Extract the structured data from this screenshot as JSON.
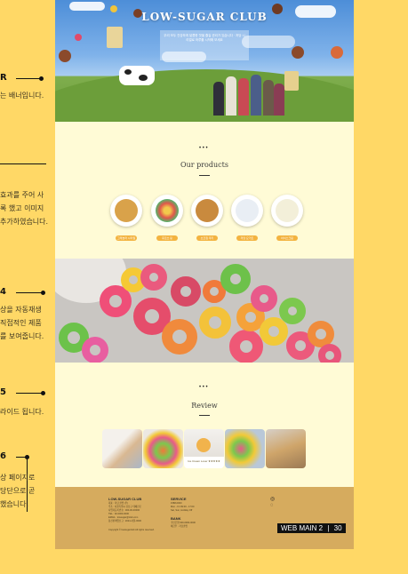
{
  "annotations": [
    {
      "num": "R",
      "lines": [
        "는 배너입니다."
      ]
    },
    {
      "num": "",
      "lines": [
        "효과를 주어 사",
        "록 했고 이미지",
        "추가하였습니다."
      ]
    },
    {
      "num": "4",
      "lines": [
        "상을 자동재생",
        "직접적인 제품",
        "를 보여줍니다."
      ]
    },
    {
      "num": "5",
      "lines": [
        "라이드 됩니다."
      ]
    },
    {
      "num": "6",
      "lines": [
        "상 페이지로",
        "당단으로 곧",
        "했습니다."
      ]
    }
  ],
  "hero": {
    "title": "LOW-SUGAR CLUB",
    "tagline": "우리 모두 건강하게 달콤한 맛을 즐길 권리가 있습니다 · 저당 시리얼로 하루를 시작해 보세요"
  },
  "products": {
    "heading": "Our products",
    "ornament": "• • •",
    "items": [
      {
        "label": "그래놀라 시리얼",
        "color": "#d9a24a"
      },
      {
        "label": "후르츠 링",
        "color": "#e0574b"
      },
      {
        "label": "초코칩 쿠키",
        "color": "#c98a3e"
      },
      {
        "label": "저당 요거트",
        "color": "#e9eef4"
      },
      {
        "label": "아이스크림",
        "color": "#f3efd9"
      }
    ]
  },
  "reviews": {
    "heading": "Review",
    "ornament": "• • •",
    "card_caption": "Ice Cream Lover ★★★★★"
  },
  "footer": {
    "brand": "LOW-SUGAR CLUB",
    "brand_text": "대표 : 저당 클럽 (주)\n주소 : 서울특별시 강남구 테헤란로\n사업자등록번호 : 000-00-00000\nTEL : 02-0000-0000\nEMAIL : lowsugar@club.com\n통신판매업신고 : 2024-서울-0000",
    "copyright": "Copyright © lowsugarclub All rights reserved.",
    "service_title": "SERVICE",
    "service_text": "1588-0000\nMon - Fri 09:00 - 17:00\nSat, Sun, Holiday Off",
    "bank_title": "BANK",
    "bank_text": "국민은행 000-0000-0000\n예금주 : 저당클럽"
  },
  "pagebar": {
    "label": "WEB MAIN 2",
    "sep": "|",
    "page": "30"
  }
}
